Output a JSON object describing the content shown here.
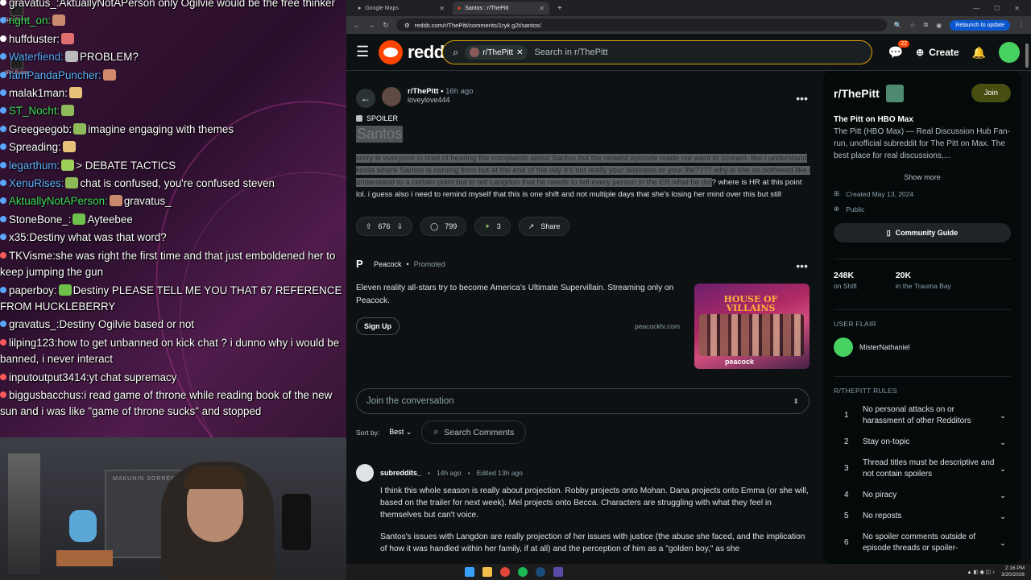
{
  "stream": {
    "chat": [
      {
        "user": "gravatus_",
        "text": "AktuallyNotAPerson only Ogilvie would be the free thinker",
        "color": "#ffffff",
        "dot": "#ffffff"
      },
      {
        "user": "right_on",
        "text": "",
        "color": "#3fe05a",
        "dot": "#5aa7ff",
        "emote": "#c98a6d"
      },
      {
        "user": "huffduster",
        "text": "",
        "color": "#ffffff",
        "dot": "#ffffff",
        "emote": "#e07070"
      },
      {
        "user": "Waterfiend",
        "text": "PROBLEM?",
        "color": "#5aa7ff",
        "dot": "#5aa7ff",
        "emote": "#bbbbbb"
      },
      {
        "user": "IamPandaPuncher",
        "text": "",
        "color": "#5fb3ff",
        "dot": "#5aa7ff",
        "emote": "#d08a6a"
      },
      {
        "user": "malak1man",
        "text": "",
        "color": "#ffffff",
        "dot": "#5aa7ff",
        "emote": "#e8c27a"
      },
      {
        "user": "ST_Nocht",
        "text": "",
        "color": "#3fe05a",
        "dot": "#5aa7ff",
        "emote": "#8dbb5a"
      },
      {
        "user": "Greegeegob",
        "text": "imagine engaging with themes",
        "color": "#ffffff",
        "dot": "#5aa7ff",
        "emote": "#8dbb5a"
      },
      {
        "user": "Spreading",
        "text": "",
        "color": "#ffffff",
        "dot": "#5aa7ff",
        "emote": "#e8c27a"
      },
      {
        "user": "legarthum",
        "text": "> DEBATE TACTICS",
        "color": "#5fb3ff",
        "dot": "#5aa7ff",
        "emote": "#9fd05a"
      },
      {
        "user": "XenuRises",
        "text": "chat is confused, you're confused steven",
        "color": "#5fb3ff",
        "dot": "#5aa7ff",
        "emote": "#8dbb5a"
      },
      {
        "user": "AktuallyNotAPerson",
        "text": "gravatus_",
        "color": "#3fe05a",
        "dot": "#5aa7ff",
        "emote": "#c98a6d"
      },
      {
        "user": "StoneBone_",
        "text": "Ayteebee",
        "color": "#ffffff",
        "dot": "#5aa7ff",
        "emote": "#6fc04a"
      },
      {
        "user": "x35",
        "text": "Destiny what was that word?",
        "color": "#ffffff",
        "dot": "#5aa7ff"
      },
      {
        "user": "TKVisme",
        "text": "she was right the first time and that just emboldened her to keep jumping the gun",
        "color": "#ffffff",
        "dot": "#ff5a5a"
      },
      {
        "user": "paperboy",
        "text": "Destiny PLEASE TELL ME YOU THAT 67 REFERENCE FROM HUCKLEBERRY",
        "color": "#ffffff",
        "dot": "#5aa7ff",
        "emote": "#6fc04a"
      },
      {
        "user": "gravatus_",
        "text": "Destiny Ogilvie based or not",
        "color": "#ffffff",
        "dot": "#5aa7ff"
      },
      {
        "user": "lilping123",
        "text": "how to get unbanned on kick chat ? i dunno why i would be banned, i never interact",
        "color": "#ffffff",
        "dot": "#ff5a5a"
      },
      {
        "user": "inputoutput3414",
        "text": "yt chat supremacy",
        "color": "#ffffff",
        "dot": "#ff5a5a"
      },
      {
        "user": "biggusbacchus",
        "text": "i read game of throne while reading book of the new sun and i was like \"game of throne sucks\" and stopped",
        "color": "#ffffff",
        "dot": "#ff5a5a"
      }
    ],
    "desktop_icons": [
      "Epic Games",
      "ARK Builder"
    ],
    "webcam_shelf_text": "MAKUNIN SORRENTON"
  },
  "browser": {
    "tabs": [
      {
        "label": "Google Maps",
        "active": false
      },
      {
        "label": "Santos : r/ThePitt",
        "active": true
      }
    ],
    "url": "reddit.com/r/ThePitt/comments/1ryk g2t/santos/",
    "relaunch_label": "Relaunch to update"
  },
  "reddit": {
    "logo_text": "reddit",
    "search": {
      "chip": "r/ThePitt",
      "placeholder": "Search in r/ThePitt"
    },
    "header": {
      "chat_badge": "22",
      "create_label": "Create"
    },
    "post": {
      "subreddit": "r/ThePitt",
      "age": "16h ago",
      "author": "loveylove444",
      "spoiler_label": "SPOILER",
      "title": "Santos",
      "body_highlighted": "sorry ik everyone is tired of hearing the complaints about Santos but the newest episode made me want to scream. like i understand kinda where Santos is coming from but at the end of the day it's not really your business or your life???? why is she so bothered like i understand to a certain point but to tell Langdon that he needs to tell every person in the ER what he did",
      "body_rest": "? where is HR at this point lol. i guess also i need to remind myself that this is one shift and not multiple days that she's losing her mind over this but still",
      "upvotes": "676",
      "comments": "799",
      "awards": "3",
      "share_label": "Share"
    },
    "promo": {
      "advertiser": "Peacock",
      "promoted_label": "Promoted",
      "text": "Eleven reality all-stars try to become America's Ultimate Supervillain. Streaming only on Peacock.",
      "cta": "Sign Up",
      "domain": "peacocktv.com",
      "image_title": "HOUSE OF VILLAINS",
      "image_brand": "peacock"
    },
    "join_placeholder": "Join the conversation",
    "sort": {
      "label": "Sort by:",
      "value": "Best",
      "search_comments": "Search Comments"
    },
    "comment": {
      "user": "subreddits_",
      "age": "14h ago",
      "edited": "Edited 13h ago",
      "p1": "I think this whole season is really about projection. Robby projects onto Mohan. Dana projects onto Emma (or she will, based on the trailer for next week). Mel projects onto Becca. Characters are struggling with what they feel in themselves but can't voice.",
      "p2": "Santos's issues with Langdon are really projection of her issues with justice (the abuse she faced, and the implication of how it was handled within her family, if at all) and the perception of him as a \"golden boy,\" as she"
    },
    "sidebar": {
      "name": "r/ThePitt",
      "join_label": "Join",
      "headline": "The Pitt on HBO Max",
      "description": "The Pitt (HBO Max) — Real Discussion Hub Fan-run, unofficial subreddit for The Pitt on Max. The best place for real discussions,...",
      "show_more": "Show more",
      "created": "Created May 13, 2024",
      "visibility": "Public",
      "guide_label": "Community Guide",
      "stats": [
        {
          "num": "248K",
          "label": "on Shift"
        },
        {
          "num": "20K",
          "label": "in the Trauma Bay"
        }
      ],
      "user_flair_heading": "USER FLAIR",
      "flair_name": "MisterNathaniel",
      "rules_heading": "R/THEPITT RULES",
      "rules": [
        {
          "n": "1",
          "t": "No personal attacks on or harassment of other Redditors"
        },
        {
          "n": "2",
          "t": "Stay on-topic"
        },
        {
          "n": "3",
          "t": "Thread titles must be descriptive and not contain spoilers"
        },
        {
          "n": "4",
          "t": "No piracy"
        },
        {
          "n": "5",
          "t": "No reposts"
        },
        {
          "n": "6",
          "t": "No spoiler comments outside of episode threads or spoiler-"
        }
      ]
    }
  },
  "taskbar": {
    "time": "2:16 PM",
    "date": "3/20/2026"
  }
}
